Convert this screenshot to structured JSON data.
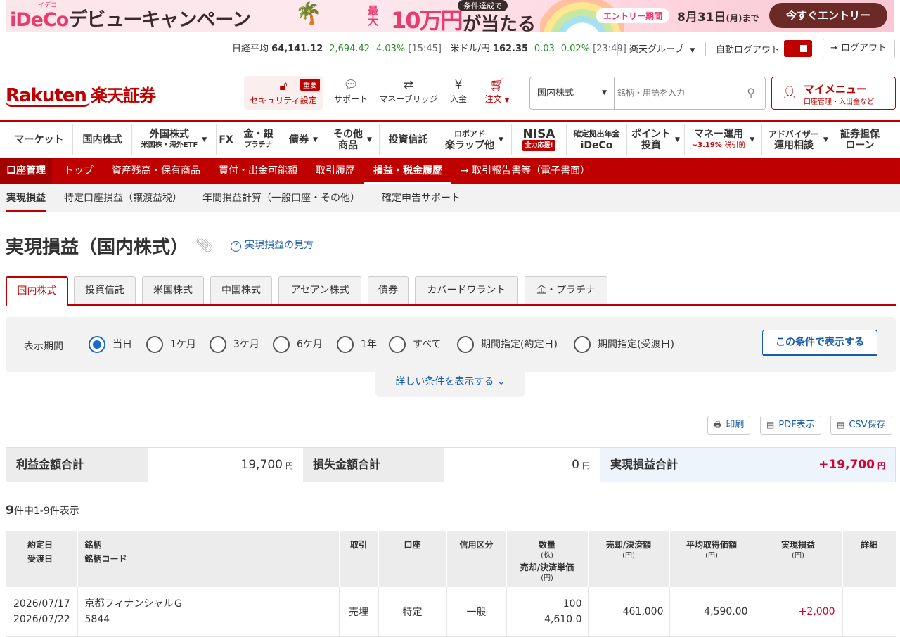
{
  "banner": {
    "ruby": "イデコ",
    "title_a": "iDeCo",
    "title_b": "デビューキャンペーン",
    "prize_pre": "最大",
    "prize_amount": "10万円",
    "prize_post": "が当たる",
    "condition": "条件達成で",
    "period_label": "エントリー期間",
    "period_date": "8月31日",
    "period_suffix": "(月)まで",
    "cta": "今すぐエントリー"
  },
  "market": {
    "nikkei_label": "日経平均",
    "nikkei_value": "64,141.12",
    "nikkei_change": "-2,694.42",
    "nikkei_pct": "-4.03%",
    "nikkei_time": "[15:45]",
    "usd_label": "米ドル/円",
    "usd_value": "162.35",
    "usd_change": "-0.03",
    "usd_pct": "-0.02%",
    "usd_time": "[23:49]",
    "group": "楽天グループ",
    "auto_logout": "自動ログアウト",
    "logout": "ログアウト"
  },
  "header": {
    "logo": "Rakuten",
    "logo_kanji": "楽天証券",
    "security": "セキュリティ設定",
    "security_badge": "重要",
    "support": "サポート",
    "money_bridge": "マネーブリッジ",
    "deposit": "入金",
    "order": "注文",
    "search_category": "国内株式",
    "search_placeholder": "銘柄・用語を入力",
    "mymenu_title": "マイメニュー",
    "mymenu_sub": "口座管理・入出金など"
  },
  "gnav": [
    {
      "label": "マーケット",
      "sub": ""
    },
    {
      "label": "国内株式",
      "sub": ""
    },
    {
      "label": "外国株式",
      "sub": "米国株・海外ETF"
    },
    {
      "label": "FX",
      "sub": ""
    },
    {
      "label": "金・銀",
      "sub": "プラチナ"
    },
    {
      "label": "債券",
      "sub": ""
    },
    {
      "label": "その他",
      "sub": "商品"
    },
    {
      "label": "投資信託",
      "sub": ""
    },
    {
      "label": "ロボアド",
      "sub": "楽ラップ他"
    },
    {
      "label": "NISA",
      "sub": "全力応援!"
    },
    {
      "label": "確定拠出年金",
      "sub": "iDeCo"
    },
    {
      "label": "ポイント",
      "sub": "投資"
    },
    {
      "label": "マネー運用",
      "sub": "~3.19%",
      "sub2": "税引前"
    },
    {
      "label": "アドバイザー",
      "sub": "運用相談"
    },
    {
      "label": "証券担保",
      "sub": "ローン"
    }
  ],
  "acct_nav": [
    "口座管理",
    "トップ",
    "資産残高・保有商品",
    "買付・出金可能額",
    "取引履歴",
    "損益・税金履歴",
    "→ 取引報告書等（電子書面）"
  ],
  "sub_nav": [
    "実現損益",
    "特定口座損益（譲渡益税）",
    "年間損益計算（一般口座・その他）",
    "確定申告サポート"
  ],
  "page": {
    "title": "実現損益（国内株式）",
    "howto": "実現損益の見方"
  },
  "market_tabs": [
    "国内株式",
    "投資信託",
    "米国株式",
    "中国株式",
    "アセアン株式",
    "債券",
    "カバードワラント",
    "金・プラチナ"
  ],
  "filter": {
    "label": "表示期間",
    "options": [
      "当日",
      "1ケ月",
      "3ケ月",
      "6ケ月",
      "1年",
      "すべて",
      "期間指定(約定日)",
      "期間指定(受渡日)"
    ],
    "selected": "当日",
    "show_button": "この条件で表示する",
    "more": "詳しい条件を表示する"
  },
  "tools": {
    "print": "印刷",
    "pdf": "PDF表示",
    "csv": "CSV保存"
  },
  "summary": {
    "profit_label": "利益金額合計",
    "profit_value": "19,700",
    "loss_label": "損失金額合計",
    "loss_value": "0",
    "total_label": "実現損益合計",
    "total_value": "+19,700",
    "unit": "円"
  },
  "count": {
    "total": "9",
    "text": "件中1-9件表示"
  },
  "table": {
    "headers": {
      "date": "約定日",
      "date2": "受渡日",
      "name": "銘柄",
      "name2": "銘柄コード",
      "trade": "取引",
      "account": "口座",
      "credit": "信用区分",
      "qty": "数量",
      "qty_u": "(株)",
      "price": "売却/決済単価",
      "price_u": "(円)",
      "amount": "売却/決済額",
      "amount_u": "(円)",
      "avg": "平均取得価額",
      "avg_u": "(円)",
      "pl": "実現損益",
      "pl_u": "(円)",
      "detail": "詳細"
    },
    "rows": [
      {
        "date": "2026/07/17",
        "date2": "2026/07/22",
        "name": "京都フィナンシャルＧ",
        "code": "5844",
        "trade": "売埋",
        "account": "特定",
        "credit": "一般",
        "qty": "100",
        "price": "4,610.0",
        "amount": "461,000",
        "avg": "4,590.00",
        "pl": "+2,000"
      }
    ]
  },
  "colors": {
    "brand": "#bf0000",
    "link": "#1a5ca8",
    "profit": "#d4002d",
    "down": "#2a8a2a"
  }
}
